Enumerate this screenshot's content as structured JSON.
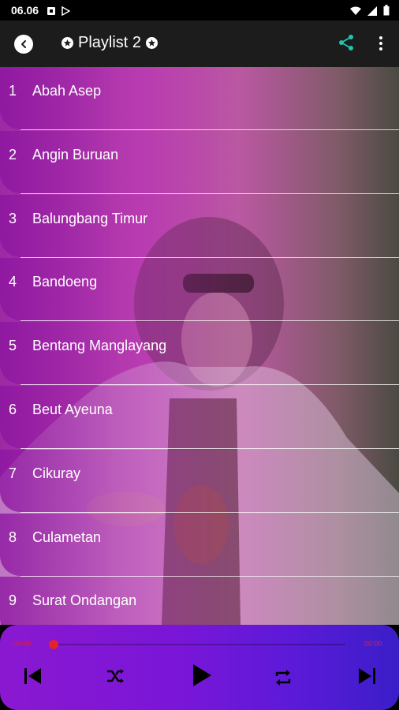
{
  "status_bar": {
    "time": "06.06"
  },
  "toolbar": {
    "title": "Playlist 2"
  },
  "playlist": [
    {
      "num": "1",
      "name": "Abah Asep"
    },
    {
      "num": "2",
      "name": "Angin Buruan"
    },
    {
      "num": "3",
      "name": "Balungbang Timur"
    },
    {
      "num": "4",
      "name": "Bandoeng"
    },
    {
      "num": "5",
      "name": "Bentang Manglayang"
    },
    {
      "num": "6",
      "name": "Beut Ayeuna"
    },
    {
      "num": "7",
      "name": "Cikuray"
    },
    {
      "num": "8",
      "name": "Culametan"
    },
    {
      "num": "9",
      "name": "Surat Ondangan"
    }
  ],
  "player": {
    "current_time": "00:00",
    "total_time": "00:00",
    "progress": 0
  },
  "colors": {
    "accent_share": "#1fc7b0",
    "seek_thumb": "#e0232f",
    "player_gradient_start": "#8a18d0",
    "player_gradient_end": "#3a1ec8"
  },
  "icons": [
    "back-icon",
    "star-icon",
    "share-icon",
    "more-vert-icon",
    "skip-previous-icon",
    "shuffle-icon",
    "play-icon",
    "repeat-icon",
    "skip-next-icon"
  ]
}
